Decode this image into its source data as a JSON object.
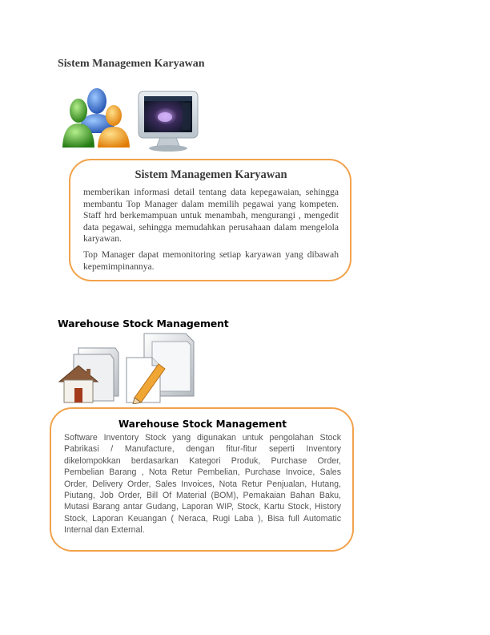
{
  "section1": {
    "heading": "Sistem Managemen Karyawan",
    "card": {
      "title": "Sistem Managemen Karyawan",
      "paragraph1": "memberikan informasi detail tentang data kepegawaian, sehingga membantu Top Manager dalam memilih pegawai yang kompeten. Staff hrd berkemampuan untuk menambah, mengurangi , mengedit data pegawai, sehingga memudahkan perusahaan dalam mengelola karyawan.",
      "paragraph2": "Top Manager dapat memonitoring setiap karyawan yang dibawah kepemimpinannya."
    },
    "icons": [
      "users-group-icon",
      "computer-monitor-icon"
    ]
  },
  "section2": {
    "heading": "Warehouse Stock Management",
    "card": {
      "title": "Warehouse Stock Management",
      "paragraph": "Software Inventory Stock yang digunakan untuk pengolahan Stock Pabrikasi / Manufacture, dengan fitur-fitur seperti Inventory dikelompokkan berdasarkan Kategori Produk, Purchase Order, Pembelian Barang , Nota Retur Pembelian, Purchase Invoice, Sales Order, Delivery Order, Sales Invoices, Nota Retur Penjualan, Hutang, Piutang, Job Order, Bill Of Material (BOM), Pemakaian Bahan Baku, Mutasi Barang antar Gudang, Laporan WIP, Stock, Kartu Stock, History Stock, Laporan Keuangan ( Neraca, Rugi Laba ), Bisa full Automatic Internal dan External."
    },
    "icons": [
      "home-folder-icon",
      "document-pencil-icon",
      "folder-icon"
    ]
  },
  "colors": {
    "card_border": "#f2a24b",
    "person_green": "#3fae2a",
    "person_blue": "#2f6fd6",
    "person_orange": "#f5a21a"
  }
}
